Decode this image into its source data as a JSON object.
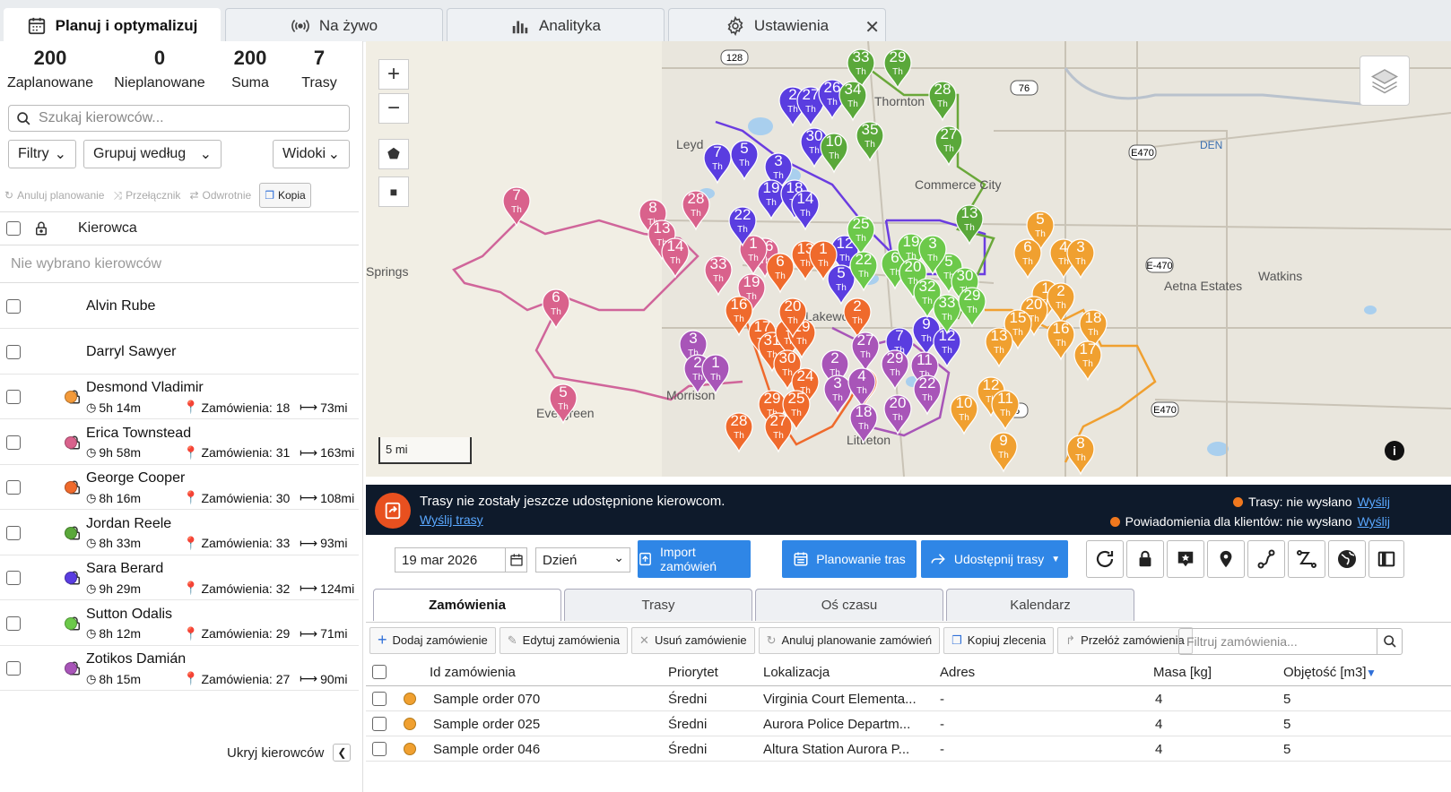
{
  "tabs": [
    {
      "label": "Planuj i optymalizuj",
      "icon": "calendar-icon"
    },
    {
      "label": "Na żywo",
      "icon": "broadcast-icon"
    },
    {
      "label": "Analityka",
      "icon": "bar-chart-icon"
    },
    {
      "label": "Ustawienia",
      "icon": "gear-icon"
    }
  ],
  "stats": [
    {
      "value": "200",
      "label": "Zaplanowane"
    },
    {
      "value": "0",
      "label": "Nieplanowane"
    },
    {
      "value": "200",
      "label": "Suma"
    },
    {
      "value": "7",
      "label": "Trasy"
    }
  ],
  "search": {
    "placeholder": "Szukaj kierowców..."
  },
  "dropdowns": {
    "filters": "Filtry",
    "group": "Grupuj według",
    "views": "Widoki"
  },
  "tools": {
    "cancel": "Anuluj planowanie",
    "switch": "Przełącznik",
    "reverse": "Odwrotnie",
    "copy": "Kopia"
  },
  "driver_header": "Kierowca",
  "no_driver": "Nie wybrano kierowców",
  "plain_drivers": [
    "Alvin Rube",
    "Darryl Sawyer"
  ],
  "drivers": [
    {
      "name": "Desmond Vladimir",
      "time": "5h 14m",
      "orders": "Zamówienia: 18",
      "dist": "73mi",
      "color": "#f39a3a"
    },
    {
      "name": "Erica Townstead",
      "time": "9h 58m",
      "orders": "Zamówienia: 31",
      "dist": "163mi",
      "color": "#d9628c"
    },
    {
      "name": "George Cooper",
      "time": "8h 16m",
      "orders": "Zamówienia: 30",
      "dist": "108mi",
      "color": "#ef6a2c"
    },
    {
      "name": "Jordan Reele",
      "time": "8h 33m",
      "orders": "Zamówienia: 33",
      "dist": "93mi",
      "color": "#5aa83a"
    },
    {
      "name": "Sara Berard",
      "time": "9h 29m",
      "orders": "Zamówienia: 32",
      "dist": "124mi",
      "color": "#5a3de0"
    },
    {
      "name": "Sutton Odalis",
      "time": "8h 12m",
      "orders": "Zamówienia: 29",
      "dist": "71mi",
      "color": "#6cc94a"
    },
    {
      "name": "Zotikos Damián",
      "time": "8h 15m",
      "orders": "Zamówienia: 27",
      "dist": "90mi",
      "color": "#a855b8"
    }
  ],
  "hide_drivers": "Ukryj kierowców",
  "map": {
    "labels": [
      "Thornton",
      "Commerce City",
      "Leyd",
      "Springs",
      "Morrison",
      "Evergreen",
      "Aetna Estates",
      "Watkins",
      "DEN",
      "Littleton",
      "Lakewood"
    ],
    "roads": [
      "128",
      "76",
      "E470",
      "E470",
      "E-470",
      "25"
    ],
    "scale": "5 mi",
    "pin_suffix": "Th"
  },
  "banner": {
    "message": "Trasy nie zostały jeszcze udostępnione kierowcom.",
    "link": "Wyślij trasy",
    "status1": "Trasy: nie wysłano",
    "status2": "Powiadomienia dla klientów: nie wysłano",
    "send": "Wyślij"
  },
  "date": "19 mar 2026",
  "period": "Dzień",
  "actions": {
    "import": "Import zamówień",
    "plan": "Planowanie tras",
    "share": "Udostępnij trasy"
  },
  "bottom_tabs": [
    "Zamówienia",
    "Trasy",
    "Oś czasu",
    "Kalendarz"
  ],
  "order_tools": [
    "Dodaj zamówienie",
    "Edytuj zamówienia",
    "Usuń zamówienie",
    "Anuluj planowanie zamówień",
    "Kopiuj zlecenia",
    "Przełóż zamówienia"
  ],
  "order_filter": {
    "placeholder": "Filtruj zamówienia..."
  },
  "table": {
    "columns": [
      "Id zamówienia",
      "Priorytet",
      "Lokalizacja",
      "Adres",
      "Masa [kg]",
      "Objętość [m3]"
    ],
    "rows": [
      [
        "Sample order 070",
        "Średni",
        "Virginia Court Elementa...",
        "-",
        "4",
        "5"
      ],
      [
        "Sample order 025",
        "Średni",
        "Aurora Police Departm...",
        "-",
        "4",
        "5"
      ],
      [
        "Sample order 046",
        "Średni",
        "Altura Station Aurora P...",
        "-",
        "4",
        "5"
      ]
    ]
  }
}
